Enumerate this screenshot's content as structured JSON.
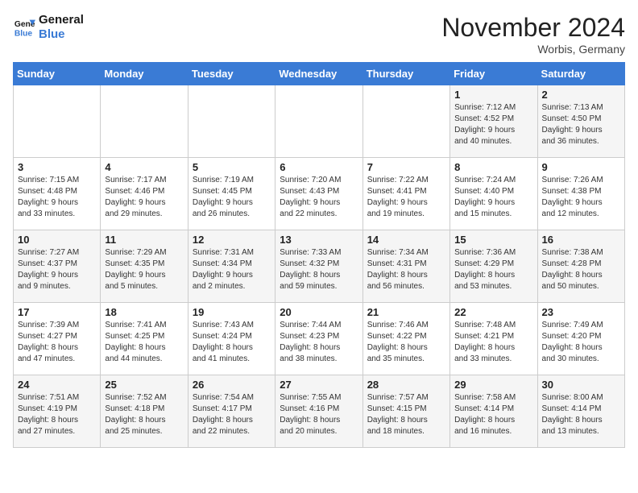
{
  "header": {
    "logo_line1": "General",
    "logo_line2": "Blue",
    "month_title": "November 2024",
    "location": "Worbis, Germany"
  },
  "days_of_week": [
    "Sunday",
    "Monday",
    "Tuesday",
    "Wednesday",
    "Thursday",
    "Friday",
    "Saturday"
  ],
  "weeks": [
    [
      {
        "day": "",
        "info": ""
      },
      {
        "day": "",
        "info": ""
      },
      {
        "day": "",
        "info": ""
      },
      {
        "day": "",
        "info": ""
      },
      {
        "day": "",
        "info": ""
      },
      {
        "day": "1",
        "info": "Sunrise: 7:12 AM\nSunset: 4:52 PM\nDaylight: 9 hours\nand 40 minutes."
      },
      {
        "day": "2",
        "info": "Sunrise: 7:13 AM\nSunset: 4:50 PM\nDaylight: 9 hours\nand 36 minutes."
      }
    ],
    [
      {
        "day": "3",
        "info": "Sunrise: 7:15 AM\nSunset: 4:48 PM\nDaylight: 9 hours\nand 33 minutes."
      },
      {
        "day": "4",
        "info": "Sunrise: 7:17 AM\nSunset: 4:46 PM\nDaylight: 9 hours\nand 29 minutes."
      },
      {
        "day": "5",
        "info": "Sunrise: 7:19 AM\nSunset: 4:45 PM\nDaylight: 9 hours\nand 26 minutes."
      },
      {
        "day": "6",
        "info": "Sunrise: 7:20 AM\nSunset: 4:43 PM\nDaylight: 9 hours\nand 22 minutes."
      },
      {
        "day": "7",
        "info": "Sunrise: 7:22 AM\nSunset: 4:41 PM\nDaylight: 9 hours\nand 19 minutes."
      },
      {
        "day": "8",
        "info": "Sunrise: 7:24 AM\nSunset: 4:40 PM\nDaylight: 9 hours\nand 15 minutes."
      },
      {
        "day": "9",
        "info": "Sunrise: 7:26 AM\nSunset: 4:38 PM\nDaylight: 9 hours\nand 12 minutes."
      }
    ],
    [
      {
        "day": "10",
        "info": "Sunrise: 7:27 AM\nSunset: 4:37 PM\nDaylight: 9 hours\nand 9 minutes."
      },
      {
        "day": "11",
        "info": "Sunrise: 7:29 AM\nSunset: 4:35 PM\nDaylight: 9 hours\nand 5 minutes."
      },
      {
        "day": "12",
        "info": "Sunrise: 7:31 AM\nSunset: 4:34 PM\nDaylight: 9 hours\nand 2 minutes."
      },
      {
        "day": "13",
        "info": "Sunrise: 7:33 AM\nSunset: 4:32 PM\nDaylight: 8 hours\nand 59 minutes."
      },
      {
        "day": "14",
        "info": "Sunrise: 7:34 AM\nSunset: 4:31 PM\nDaylight: 8 hours\nand 56 minutes."
      },
      {
        "day": "15",
        "info": "Sunrise: 7:36 AM\nSunset: 4:29 PM\nDaylight: 8 hours\nand 53 minutes."
      },
      {
        "day": "16",
        "info": "Sunrise: 7:38 AM\nSunset: 4:28 PM\nDaylight: 8 hours\nand 50 minutes."
      }
    ],
    [
      {
        "day": "17",
        "info": "Sunrise: 7:39 AM\nSunset: 4:27 PM\nDaylight: 8 hours\nand 47 minutes."
      },
      {
        "day": "18",
        "info": "Sunrise: 7:41 AM\nSunset: 4:25 PM\nDaylight: 8 hours\nand 44 minutes."
      },
      {
        "day": "19",
        "info": "Sunrise: 7:43 AM\nSunset: 4:24 PM\nDaylight: 8 hours\nand 41 minutes."
      },
      {
        "day": "20",
        "info": "Sunrise: 7:44 AM\nSunset: 4:23 PM\nDaylight: 8 hours\nand 38 minutes."
      },
      {
        "day": "21",
        "info": "Sunrise: 7:46 AM\nSunset: 4:22 PM\nDaylight: 8 hours\nand 35 minutes."
      },
      {
        "day": "22",
        "info": "Sunrise: 7:48 AM\nSunset: 4:21 PM\nDaylight: 8 hours\nand 33 minutes."
      },
      {
        "day": "23",
        "info": "Sunrise: 7:49 AM\nSunset: 4:20 PM\nDaylight: 8 hours\nand 30 minutes."
      }
    ],
    [
      {
        "day": "24",
        "info": "Sunrise: 7:51 AM\nSunset: 4:19 PM\nDaylight: 8 hours\nand 27 minutes."
      },
      {
        "day": "25",
        "info": "Sunrise: 7:52 AM\nSunset: 4:18 PM\nDaylight: 8 hours\nand 25 minutes."
      },
      {
        "day": "26",
        "info": "Sunrise: 7:54 AM\nSunset: 4:17 PM\nDaylight: 8 hours\nand 22 minutes."
      },
      {
        "day": "27",
        "info": "Sunrise: 7:55 AM\nSunset: 4:16 PM\nDaylight: 8 hours\nand 20 minutes."
      },
      {
        "day": "28",
        "info": "Sunrise: 7:57 AM\nSunset: 4:15 PM\nDaylight: 8 hours\nand 18 minutes."
      },
      {
        "day": "29",
        "info": "Sunrise: 7:58 AM\nSunset: 4:14 PM\nDaylight: 8 hours\nand 16 minutes."
      },
      {
        "day": "30",
        "info": "Sunrise: 8:00 AM\nSunset: 4:14 PM\nDaylight: 8 hours\nand 13 minutes."
      }
    ]
  ]
}
